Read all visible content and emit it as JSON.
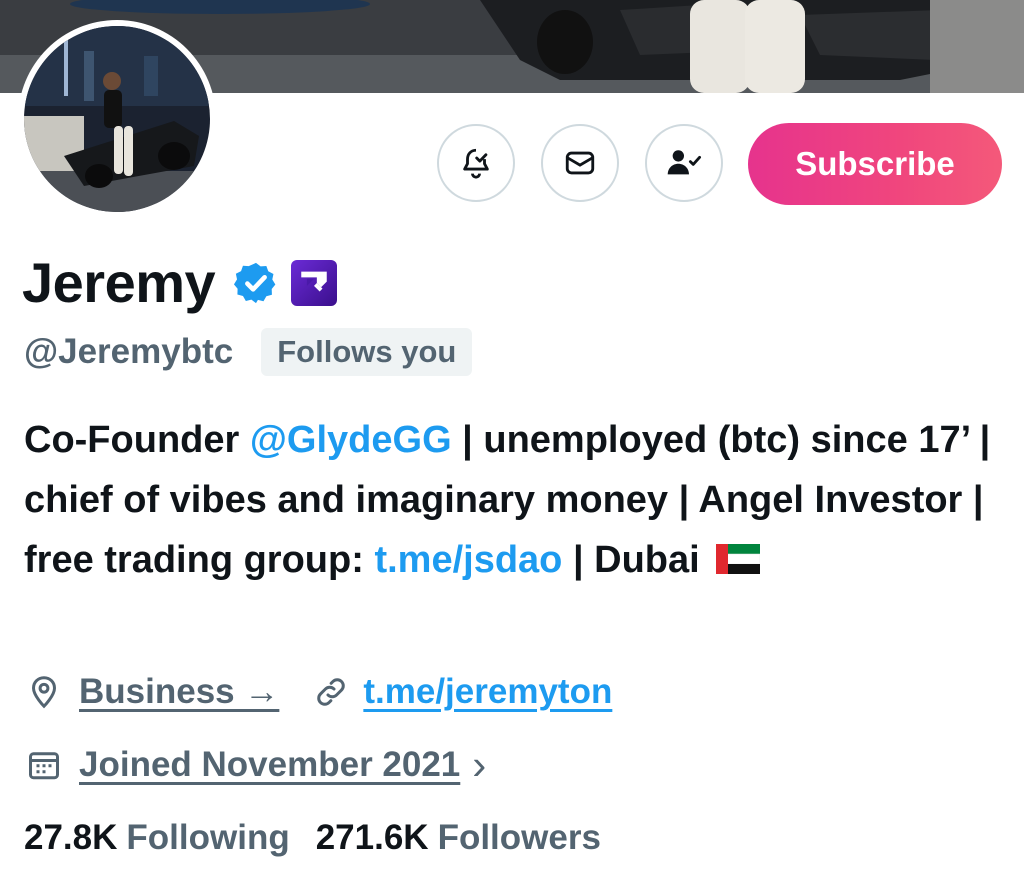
{
  "header": {
    "subscribe_label": "Subscribe",
    "accent_gradient": [
      "#e6338d",
      "#f4597a"
    ]
  },
  "profile": {
    "display_name": "Jeremy",
    "handle": "@Jeremybtc",
    "follows_you": "Follows you",
    "bio_parts": {
      "p1": "Co-Founder ",
      "mention": "@GlydeGG",
      "p2": " | unemployed (btc) since 17’ | chief of vibes and imaginary money | Angel Investor | free trading group: ",
      "link": "t.me/jsdao",
      "p3": " | Dubai"
    },
    "category": "Business →",
    "website": "t.me/jeremyton",
    "joined": "Joined November 2021",
    "joined_chevron": "›"
  },
  "stats": {
    "following_count": "27.8K",
    "following_label": "Following",
    "followers_count": "271.6K",
    "followers_label": "Followers"
  },
  "icons": {
    "notify": "bell-check-icon",
    "message": "envelope-icon",
    "follow": "person-check-icon",
    "verified": "verified-badge-icon",
    "affiliate": "affiliate-badge-icon",
    "location": "location-pin-icon",
    "link": "link-icon",
    "calendar": "calendar-icon",
    "flag": "uae-flag-icon"
  },
  "colors": {
    "link_blue": "#1d9bf0",
    "secondary_text": "#536471",
    "primary_text": "#0f1419"
  }
}
